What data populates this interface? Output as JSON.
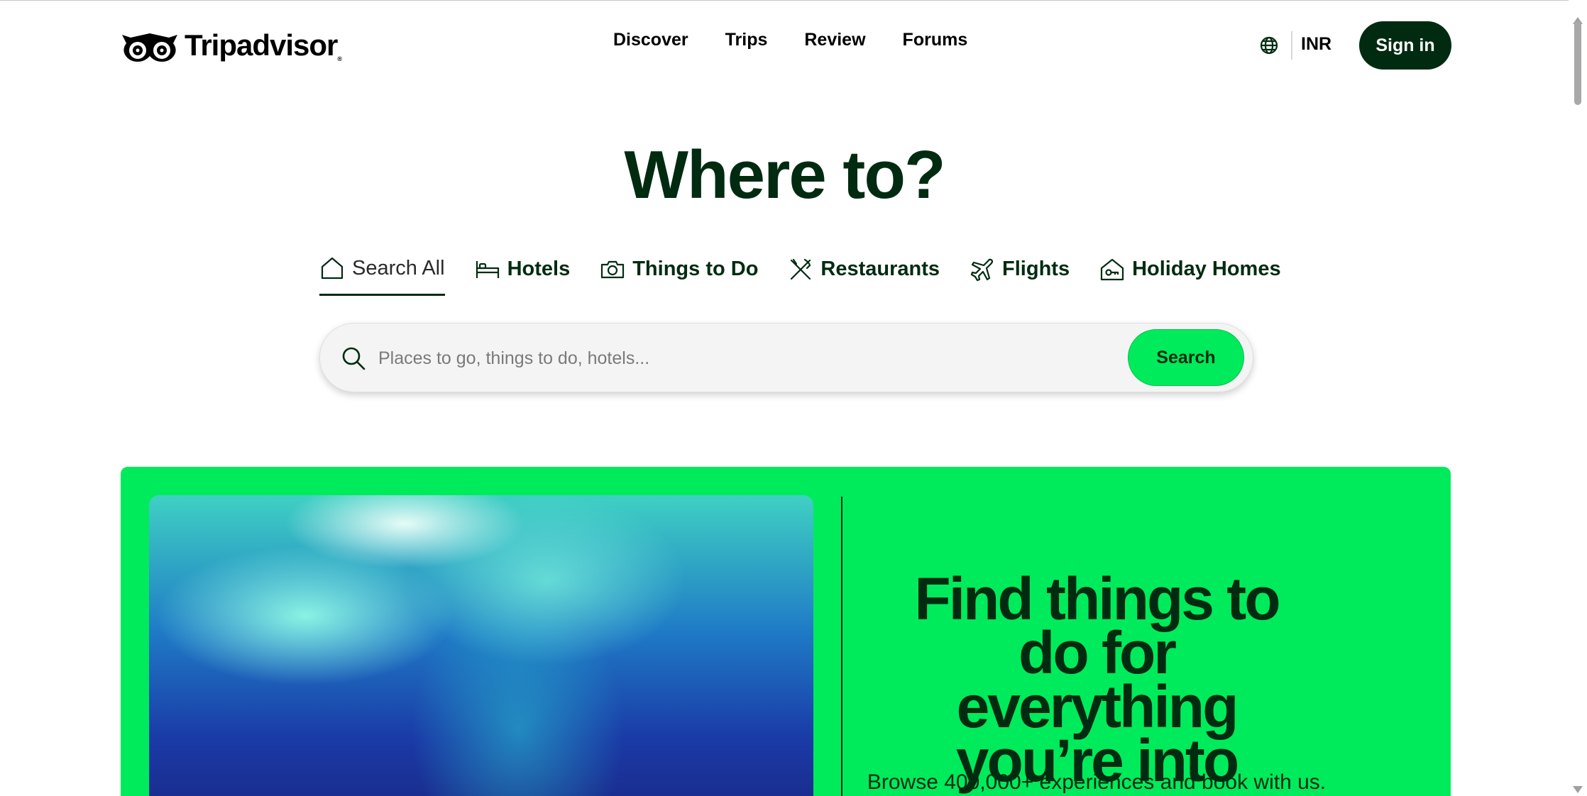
{
  "header": {
    "logo_text": "Tripadvisor",
    "logo_reg": "®",
    "nav": [
      "Discover",
      "Trips",
      "Review",
      "Forums"
    ],
    "currency": "INR",
    "signin_label": "Sign in",
    "icons": {
      "language": "globe-icon"
    }
  },
  "hero": {
    "headline": "Where to?",
    "tabs": [
      {
        "label": "Search All",
        "icon": "home-icon",
        "active": true
      },
      {
        "label": "Hotels",
        "icon": "bed-icon",
        "active": false
      },
      {
        "label": "Things to Do",
        "icon": "camera-icon",
        "active": false
      },
      {
        "label": "Restaurants",
        "icon": "cutlery-icon",
        "active": false
      },
      {
        "label": "Flights",
        "icon": "plane-icon",
        "active": false
      },
      {
        "label": "Holiday Homes",
        "icon": "house-key-icon",
        "active": false
      }
    ],
    "search": {
      "placeholder": "Places to go, things to do, hotels...",
      "value": "",
      "button_label": "Search"
    }
  },
  "promo": {
    "title": "Find things to do for everything you’re into",
    "subtitle": "Browse 400,000+ experiences and book with us."
  },
  "colors": {
    "brand_dark": "#002b11",
    "brand_green": "#00eb5b",
    "background": "#ffffff"
  }
}
